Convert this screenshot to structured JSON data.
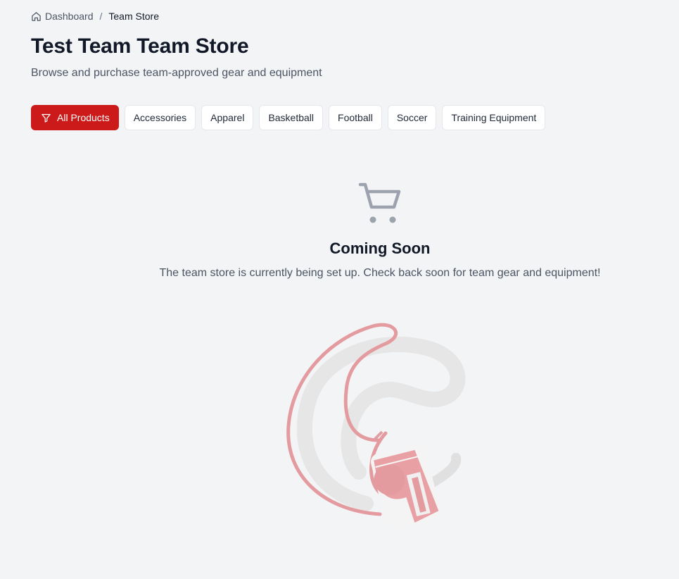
{
  "breadcrumb": {
    "home_label": "Dashboard",
    "separator": "/",
    "current_label": "Team Store"
  },
  "header": {
    "title": "Test Team Team Store",
    "subtitle": "Browse and purchase team-approved gear and equipment"
  },
  "filters": {
    "active": "All Products",
    "items": [
      {
        "label": "All Products",
        "icon": "filter-icon"
      },
      {
        "label": "Accessories"
      },
      {
        "label": "Apparel"
      },
      {
        "label": "Basketball"
      },
      {
        "label": "Football"
      },
      {
        "label": "Soccer"
      },
      {
        "label": "Training Equipment"
      }
    ]
  },
  "empty_state": {
    "icon": "shopping-cart-icon",
    "title": "Coming Soon",
    "description": "The team store is currently being set up. Check back soon for team gear and equipment!",
    "illustration": "whistle-illustration"
  },
  "colors": {
    "accent": "#cc1a1a",
    "background": "#f3f4f6",
    "muted_icon": "#9ca3af"
  }
}
